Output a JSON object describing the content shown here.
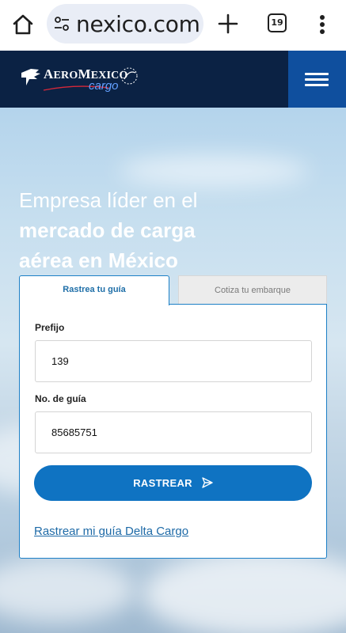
{
  "browser": {
    "url": "nexico.com",
    "tab_count": "19",
    "icons": [
      "home-icon",
      "site-settings-icon",
      "new-tab-icon",
      "tab-switcher-icon",
      "more-menu-icon"
    ]
  },
  "header": {
    "logo_main_prefix": "A",
    "logo_main_rest": "ERO",
    "logo_main_prefix2": "M",
    "logo_main_rest2": "EXICO",
    "logo_sub": "cargo",
    "brand_color": "#0b2244",
    "menu_color": "#0f4f9e"
  },
  "hero": {
    "headline_line1": "Empresa líder en el",
    "headline_line2": "mercado de carga",
    "headline_line3": "aérea en México"
  },
  "tracking": {
    "tab_active": "Rastrea tu guía",
    "tab_inactive": "Cotiza tu embarque",
    "prefix_label": "Prefijo",
    "prefix_value": "139",
    "guide_label": "No. de guía",
    "guide_value": "85685751",
    "submit_label": "RASTREAR",
    "delta_link": "Rastrear mi guía Delta Cargo",
    "accent_color": "#0f73c2"
  }
}
